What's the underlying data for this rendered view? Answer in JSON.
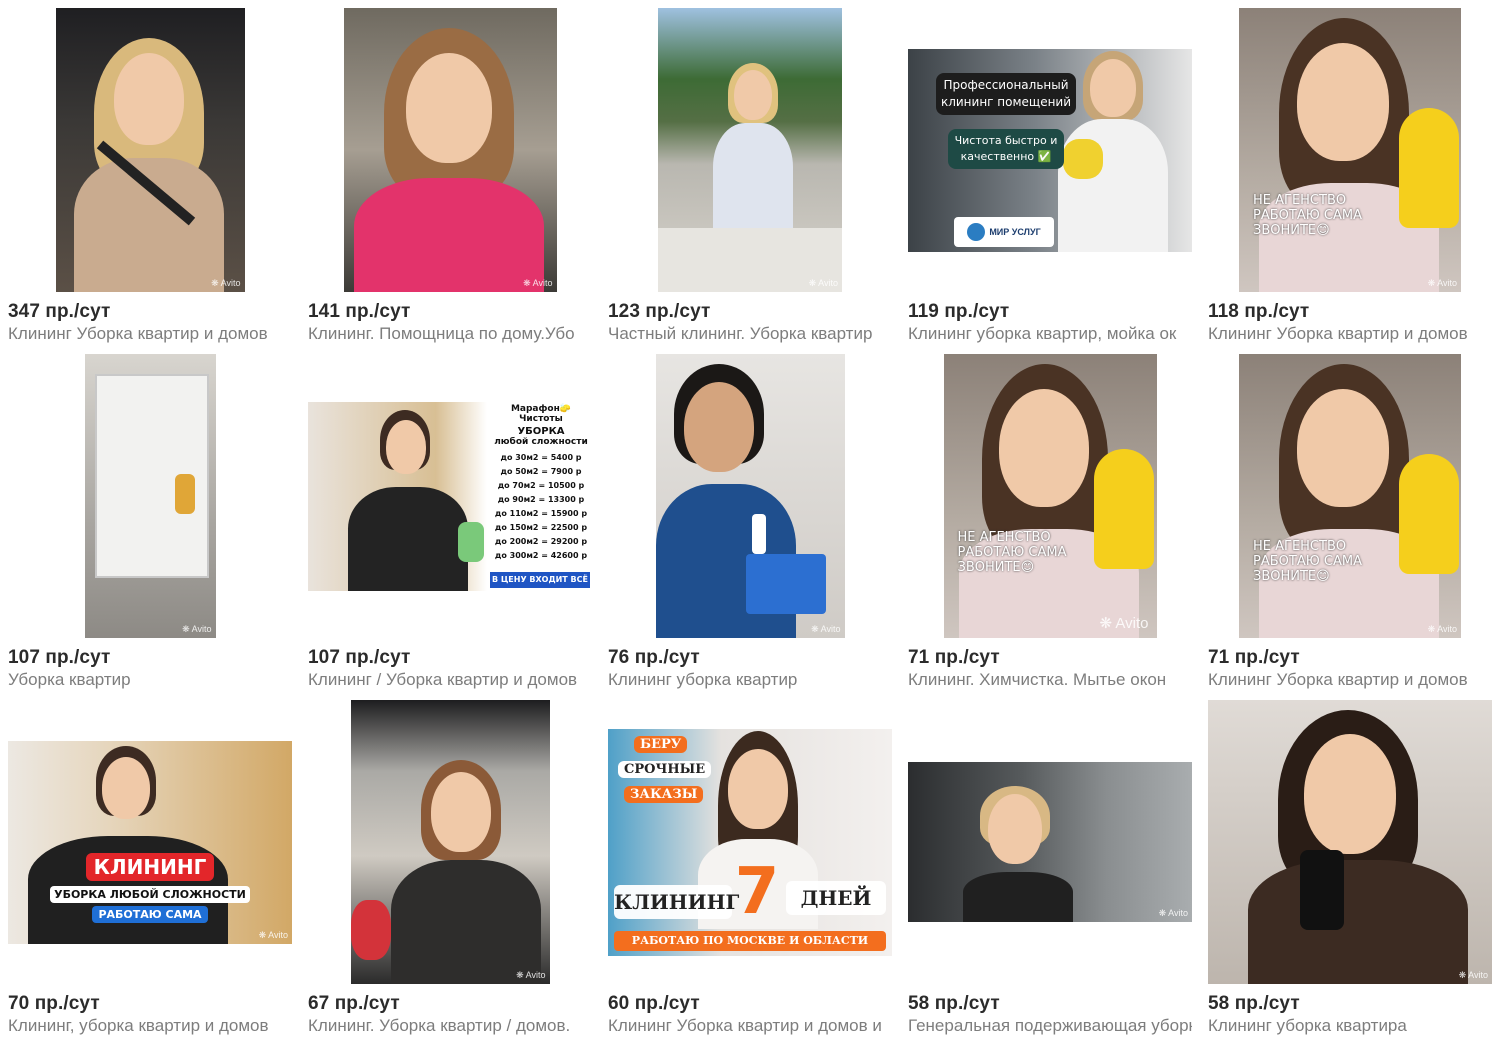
{
  "watermark": "Avito",
  "listings": [
    {
      "price": "347 пр./сут",
      "title": "Клининг Уборка квартир и домов"
    },
    {
      "price": "141 пр./сут",
      "title": "Клининг. Помощница по дому.Убо"
    },
    {
      "price": "123 пр./сут",
      "title": "Частный клининг. Уборка квартир"
    },
    {
      "price": "119 пр./сут",
      "title": "Клининг уборка квартир, мойка ок",
      "overlay": {
        "line1": "Профессиональный",
        "line2": "клининг помещений",
        "line3": "Чистота быстро и",
        "line4": "качественно ✅",
        "brand": "МИР УСЛУГ"
      }
    },
    {
      "price": "118 пр./сут",
      "title": "Клининг Уборка квартир и домов",
      "overlay": {
        "line1": "НЕ АГЕНСТВО",
        "line2": "РАБОТАЮ САМА",
        "line3": "ЗВОНИТЕ😊"
      }
    },
    {
      "price": "107 пр./сут",
      "title": "Уборка квартир"
    },
    {
      "price": "107 пр./сут",
      "title": "Клининг / Уборка квартир и домов",
      "overlay": {
        "header": "Марафон🧽Чистоты",
        "sub1": "УБОРКА",
        "sub2": "любой сложности",
        "prices": [
          "до 30м2 = 5400 р",
          "до 50м2 = 7900 р",
          "до 70м2 = 10500 р",
          "до 90м2 = 13300 р",
          "до 110м2 = 15900 р",
          "до 150м2 = 22500 р",
          "до 200м2 = 29200 р",
          "до 300м2 = 42600 р"
        ],
        "footer": "В ЦЕНУ ВХОДИТ ВСЁ"
      }
    },
    {
      "price": "76 пр./сут",
      "title": "Клининг уборка квартир"
    },
    {
      "price": "71 пр./сут",
      "title": "Клининг. Химчистка. Мытье окон",
      "overlay": {
        "line1": "НЕ АГЕНСТВО",
        "line2": "РАБОТАЮ САМА",
        "line3": "ЗВОНИТЕ😊"
      }
    },
    {
      "price": "71 пр./сут",
      "title": "Клининг Уборка квартир и домов",
      "overlay": {
        "line1": "НЕ АГЕНСТВО",
        "line2": "РАБОТАЮ САМА",
        "line3": "ЗВОНИТЕ😊"
      }
    },
    {
      "price": "70 пр./сут",
      "title": "Клининг, уборка квартир и домов",
      "overlay": {
        "line1": "КЛИНИНГ",
        "line2": "УБОРКА ЛЮБОЙ СЛОЖНОСТИ",
        "line3": "РАБОТАЮ САМА"
      }
    },
    {
      "price": "67 пр./сут",
      "title": "Клининг. Уборка квартир / домов."
    },
    {
      "price": "60 пр./сут",
      "title": "Клининг Уборка квартир и домов и",
      "overlay": {
        "tag1": "БЕРУ",
        "tag2": "СРОЧНЫЕ",
        "tag3": "ЗАКАЗЫ",
        "word1": "КЛИНИНГ",
        "num": "7",
        "word2": "ДНЕЙ",
        "footer": "РАБОТАЮ ПО МОСКВЕ И ОБЛАСТИ"
      }
    },
    {
      "price": "58 пр./сут",
      "title": "Генеральная подерживающая уборк"
    },
    {
      "price": "58 пр./сут",
      "title": "Клининг уборка квартира"
    }
  ]
}
